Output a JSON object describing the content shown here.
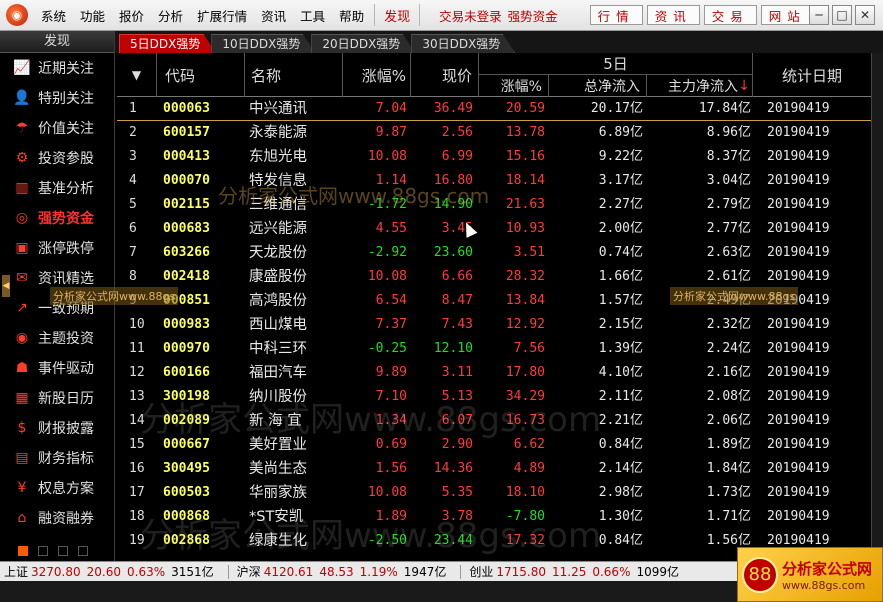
{
  "menubar": {
    "logo_icon": "app-logo-icon",
    "items": [
      "系统",
      "功能",
      "报价",
      "分析",
      "扩展行情",
      "资讯",
      "工具",
      "帮助"
    ],
    "discover_label": "发现",
    "login_status": "交易未登录",
    "module_label": "强势资金",
    "quick_buttons": [
      "行情",
      "资讯",
      "交易",
      "网站"
    ],
    "window_buttons": [
      "─",
      "□",
      "✕"
    ]
  },
  "sidebar": {
    "title": "发现",
    "items": [
      {
        "label": "近期关注",
        "icon": "trend-chart-icon",
        "glyph": "📈"
      },
      {
        "label": "特别关注",
        "icon": "person-icon",
        "glyph": "👤"
      },
      {
        "label": "价值关注",
        "icon": "umbrella-icon",
        "glyph": "☂"
      },
      {
        "label": "投资参股",
        "icon": "handshake-icon",
        "glyph": "⚙"
      },
      {
        "label": "基准分析",
        "icon": "bar-chart-icon",
        "glyph": "▥"
      },
      {
        "label": "强势资金",
        "icon": "lifebuoy-icon",
        "glyph": "◎",
        "active": true
      },
      {
        "label": "涨停跌停",
        "icon": "wallet-icon",
        "glyph": "▣"
      },
      {
        "label": "资讯精选",
        "icon": "chat-icon",
        "glyph": "✉"
      },
      {
        "label": "一致预期",
        "icon": "line-chart-icon",
        "glyph": "↗"
      },
      {
        "label": "主题投资",
        "icon": "target-icon",
        "glyph": "◉"
      },
      {
        "label": "事件驱动",
        "icon": "bell-icon",
        "glyph": "☗"
      },
      {
        "label": "新股日历",
        "icon": "calendar-icon",
        "glyph": "▦"
      },
      {
        "label": "财报披露",
        "icon": "coin-icon",
        "glyph": "$"
      },
      {
        "label": "财务指标",
        "icon": "document-icon",
        "glyph": "▤"
      },
      {
        "label": "权息方案",
        "icon": "money-icon",
        "glyph": "¥"
      },
      {
        "label": "融资融券",
        "icon": "bank-icon",
        "glyph": "⌂"
      }
    ]
  },
  "tabs": [
    "5日DDX强势",
    "10日DDX强势",
    "20日DDX强势",
    "30日DDX强势"
  ],
  "table": {
    "headers": {
      "sort": "▼",
      "code": "代码",
      "name": "名称",
      "change": "涨幅%",
      "price": "现价",
      "group": "5日",
      "change5": "涨幅%",
      "netflow": "总净流入",
      "mainflow": "主力净流入",
      "mainflow_arrow": "↓",
      "date": "统计日期"
    },
    "rows": [
      {
        "idx": "1",
        "code": "000063",
        "name": "中兴通讯",
        "chg": "7.04",
        "price": "36.49",
        "chg5": "20.59",
        "net": "20.17亿",
        "main": "17.84亿",
        "date": "20190419",
        "chg_dir": "up",
        "price_dir": "up",
        "chg5_dir": "up"
      },
      {
        "idx": "2",
        "code": "600157",
        "name": "永泰能源",
        "chg": "9.87",
        "price": "2.56",
        "chg5": "13.78",
        "net": "6.89亿",
        "main": "8.96亿",
        "date": "20190419",
        "chg_dir": "up",
        "price_dir": "up",
        "chg5_dir": "up"
      },
      {
        "idx": "3",
        "code": "000413",
        "name": "东旭光电",
        "chg": "10.08",
        "price": "6.99",
        "chg5": "15.16",
        "net": "9.22亿",
        "main": "8.37亿",
        "date": "20190419",
        "chg_dir": "up",
        "price_dir": "up",
        "chg5_dir": "up"
      },
      {
        "idx": "4",
        "code": "000070",
        "name": "特发信息",
        "chg": "1.14",
        "price": "16.80",
        "chg5": "18.14",
        "net": "3.17亿",
        "main": "3.04亿",
        "date": "20190419",
        "chg_dir": "up",
        "price_dir": "up",
        "chg5_dir": "up"
      },
      {
        "idx": "5",
        "code": "002115",
        "name": "三维通信",
        "chg": "-1.72",
        "price": "14.90",
        "chg5": "21.63",
        "net": "2.27亿",
        "main": "2.79亿",
        "date": "20190419",
        "chg_dir": "down",
        "price_dir": "down",
        "chg5_dir": "up"
      },
      {
        "idx": "6",
        "code": "000683",
        "name": "远兴能源",
        "chg": "4.55",
        "price": "3.45",
        "chg5": "10.93",
        "net": "2.00亿",
        "main": "2.77亿",
        "date": "20190419",
        "chg_dir": "up",
        "price_dir": "up",
        "chg5_dir": "up"
      },
      {
        "idx": "7",
        "code": "603266",
        "name": "天龙股份",
        "chg": "-2.92",
        "price": "23.60",
        "chg5": "3.51",
        "net": "0.74亿",
        "main": "2.63亿",
        "date": "20190419",
        "chg_dir": "down",
        "price_dir": "down",
        "chg5_dir": "up"
      },
      {
        "idx": "8",
        "code": "002418",
        "name": "康盛股份",
        "chg": "10.08",
        "price": "6.66",
        "chg5": "28.32",
        "net": "1.66亿",
        "main": "2.61亿",
        "date": "20190419",
        "chg_dir": "up",
        "price_dir": "up",
        "chg5_dir": "up"
      },
      {
        "idx": "9",
        "code": "000851",
        "name": "高鸿股份",
        "chg": "6.54",
        "price": "8.47",
        "chg5": "13.84",
        "net": "1.57亿",
        "main": "2.49亿",
        "date": "20190419",
        "chg_dir": "up",
        "price_dir": "up",
        "chg5_dir": "up"
      },
      {
        "idx": "10",
        "code": "000983",
        "name": "西山煤电",
        "chg": "7.37",
        "price": "7.43",
        "chg5": "12.92",
        "net": "2.15亿",
        "main": "2.32亿",
        "date": "20190419",
        "chg_dir": "up",
        "price_dir": "up",
        "chg5_dir": "up"
      },
      {
        "idx": "11",
        "code": "000970",
        "name": "中科三环",
        "chg": "-0.25",
        "price": "12.10",
        "chg5": "7.56",
        "net": "1.39亿",
        "main": "2.24亿",
        "date": "20190419",
        "chg_dir": "down",
        "price_dir": "down",
        "chg5_dir": "up"
      },
      {
        "idx": "12",
        "code": "600166",
        "name": "福田汽车",
        "chg": "9.89",
        "price": "3.11",
        "chg5": "17.80",
        "net": "4.10亿",
        "main": "2.16亿",
        "date": "20190419",
        "chg_dir": "up",
        "price_dir": "up",
        "chg5_dir": "up"
      },
      {
        "idx": "13",
        "code": "300198",
        "name": "纳川股份",
        "chg": "7.10",
        "price": "5.13",
        "chg5": "34.29",
        "net": "2.11亿",
        "main": "2.08亿",
        "date": "20190419",
        "chg_dir": "up",
        "price_dir": "up",
        "chg5_dir": "up"
      },
      {
        "idx": "14",
        "code": "002089",
        "name": "新 海 宜",
        "chg": "1.34",
        "price": "6.07",
        "chg5": "16.73",
        "net": "2.21亿",
        "main": "2.06亿",
        "date": "20190419",
        "chg_dir": "up",
        "price_dir": "up",
        "chg5_dir": "up"
      },
      {
        "idx": "15",
        "code": "000667",
        "name": "美好置业",
        "chg": "0.69",
        "price": "2.90",
        "chg5": "6.62",
        "net": "0.84亿",
        "main": "1.89亿",
        "date": "20190419",
        "chg_dir": "up",
        "price_dir": "up",
        "chg5_dir": "up"
      },
      {
        "idx": "16",
        "code": "300495",
        "name": "美尚生态",
        "chg": "1.56",
        "price": "14.36",
        "chg5": "4.89",
        "net": "2.14亿",
        "main": "1.84亿",
        "date": "20190419",
        "chg_dir": "up",
        "price_dir": "up",
        "chg5_dir": "up"
      },
      {
        "idx": "17",
        "code": "600503",
        "name": "华丽家族",
        "chg": "10.08",
        "price": "5.35",
        "chg5": "18.10",
        "net": "2.98亿",
        "main": "1.73亿",
        "date": "20190419",
        "chg_dir": "up",
        "price_dir": "up",
        "chg5_dir": "up"
      },
      {
        "idx": "18",
        "code": "000868",
        "name": "*ST安凯",
        "chg": "1.89",
        "price": "3.78",
        "chg5": "-7.80",
        "net": "1.30亿",
        "main": "1.71亿",
        "date": "20190419",
        "chg_dir": "up",
        "price_dir": "up",
        "chg5_dir": "down"
      },
      {
        "idx": "19",
        "code": "002868",
        "name": "绿康生化",
        "chg": "-2.50",
        "price": "23.44",
        "chg5": "17.32",
        "net": "0.84亿",
        "main": "1.56亿",
        "date": "20190419",
        "chg_dir": "down",
        "price_dir": "down",
        "chg5_dir": "up"
      }
    ]
  },
  "statusbar": {
    "sh": {
      "label": "上证",
      "price": "3270.80",
      "change": "20.60",
      "pct": "0.63%",
      "amount": "3151亿"
    },
    "hs": {
      "label": "沪深",
      "price": "4120.61",
      "change": "48.53",
      "pct": "1.19%",
      "amount": "1947亿"
    },
    "cy": {
      "label": "创业",
      "price": "1715.80",
      "change": "11.25",
      "pct": "0.66%",
      "amount": "1099亿"
    }
  },
  "watermarks": {
    "mid": "分析家公式网www.88gs.com",
    "big1": "分析家公式网www.88gs.com",
    "big2": "分析家公式网www.88gs.com",
    "box_left": "分析家公式网www.88gs",
    "box_right": "分析家公式网www.88gs",
    "corner_title": "分析家公式网",
    "corner_url": "www.88gs.com",
    "corner_icon": "88"
  },
  "colors": {
    "up": "#ff3b3b",
    "down": "#22dd22",
    "code": "#ffff55",
    "accent": "#c00000"
  }
}
